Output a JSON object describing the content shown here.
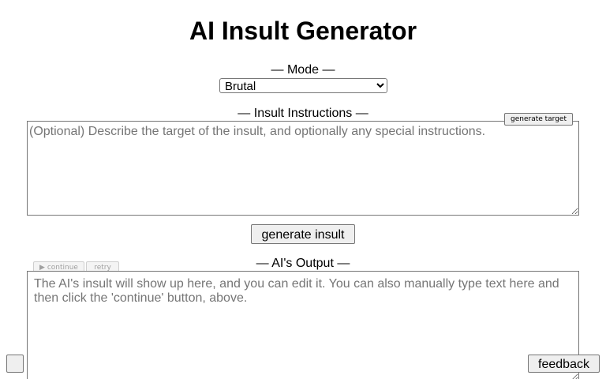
{
  "header": {
    "title": "AI Insult Generator"
  },
  "mode": {
    "label": "— Mode —",
    "selected": "Brutal",
    "selected_icon": "",
    "options": [
      "Brutal"
    ]
  },
  "instructions": {
    "label": "— Insult Instructions —",
    "placeholder": "(Optional) Describe the target of the insult, and optionally any special instructions.",
    "generate_target_icon": "",
    "generate_target_label": "generate target"
  },
  "actions": {
    "generate_insult_icon": "",
    "generate_insult_label": "generate insult"
  },
  "output": {
    "label": "— AI's Output —",
    "placeholder": "The AI's insult will show up here, and you can edit it. You can also manually type text here and then click the 'continue' button, above.",
    "continue_icon": "▶",
    "continue_label": "continue",
    "retry_icon": "",
    "retry_label": "retry"
  },
  "footer": {
    "left_button_icon": "",
    "feedback_icon": "",
    "feedback_label": "feedback"
  }
}
